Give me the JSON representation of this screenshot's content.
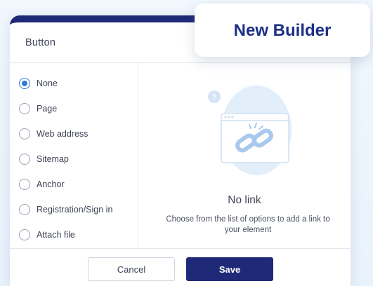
{
  "dialog": {
    "title": "Button",
    "options": [
      {
        "label": "None",
        "checked": true
      },
      {
        "label": "Page",
        "checked": false
      },
      {
        "label": "Web address",
        "checked": false
      },
      {
        "label": "Sitemap",
        "checked": false
      },
      {
        "label": "Anchor",
        "checked": false
      },
      {
        "label": "Registration/Sign in",
        "checked": false
      },
      {
        "label": "Attach file",
        "checked": false
      }
    ],
    "empty_state": {
      "title": "No link",
      "description": "Choose from the list of options to add a link to your element",
      "icon": "broken-link-icon"
    },
    "footer": {
      "cancel_label": "Cancel",
      "save_label": "Save"
    }
  },
  "badge": {
    "label": "New Builder"
  },
  "colors": {
    "accent": "#1e2a78",
    "radio_selected": "#2f7be0",
    "badge_text": "#1c2f86",
    "background": "#eef5fb"
  }
}
